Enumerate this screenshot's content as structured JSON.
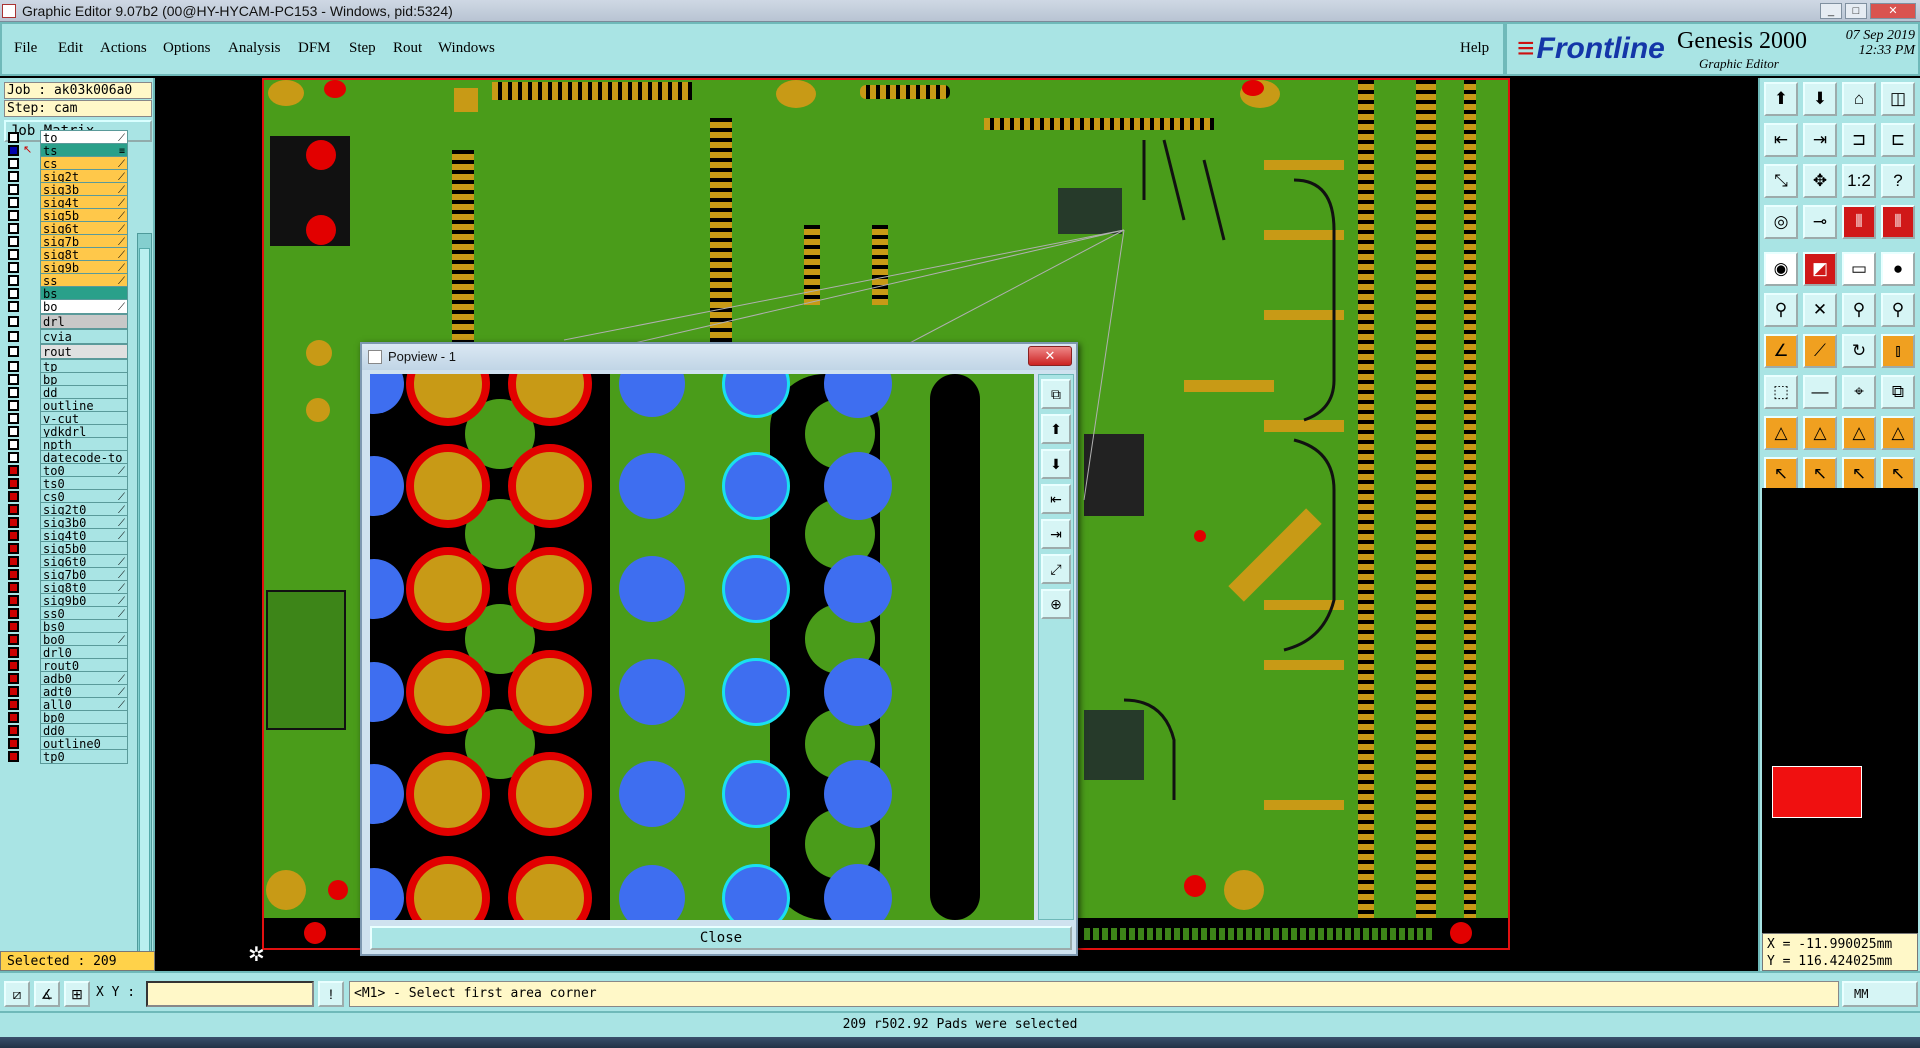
{
  "window": {
    "title": "Graphic Editor 9.07b2 (00@HY-HYCAM-PC153 - Windows, pid:5324)",
    "min": "_",
    "max": "□",
    "close": "✕"
  },
  "menu": {
    "items": [
      "File",
      "Edit",
      "Actions",
      "Options",
      "Analysis",
      "DFM",
      "Step",
      "Rout",
      "Windows"
    ],
    "help": "Help"
  },
  "brand": {
    "logo": "Frontline",
    "product": "Genesis 2000",
    "subtitle": "Graphic Editor",
    "date": "07 Sep 2019",
    "time": "12:33 PM"
  },
  "job": {
    "job_label": "Job : ak03k006a0",
    "step_label": "Step: cam",
    "matrix_button": "Job Matrix ..."
  },
  "layers": [
    {
      "name": "to",
      "color": "#ffffff",
      "check": "white",
      "mark": "⟋"
    },
    {
      "name": "ts",
      "color": "#2aa08a",
      "check": "blue",
      "mark": "≡",
      "arrow": true
    },
    {
      "name": "cs",
      "color": "#ffc84a",
      "check": "white",
      "mark": "⟋"
    },
    {
      "name": "sig2t",
      "color": "#ffc84a",
      "check": "white",
      "mark": "⟋"
    },
    {
      "name": "sig3b",
      "color": "#ffc84a",
      "check": "white",
      "mark": "⟋"
    },
    {
      "name": "sig4t",
      "color": "#ffc84a",
      "check": "white",
      "mark": "⟋"
    },
    {
      "name": "sig5b",
      "color": "#ffc84a",
      "check": "white",
      "mark": "⟋"
    },
    {
      "name": "sig6t",
      "color": "#ffc84a",
      "check": "white",
      "mark": "⟋"
    },
    {
      "name": "sig7b",
      "color": "#ffc84a",
      "check": "white",
      "mark": "⟋"
    },
    {
      "name": "sig8t",
      "color": "#ffc84a",
      "check": "white",
      "mark": "⟋"
    },
    {
      "name": "sig9b",
      "color": "#ffc84a",
      "check": "white",
      "mark": "⟋"
    },
    {
      "name": "ss",
      "color": "#ffc84a",
      "check": "white",
      "mark": "⟋"
    },
    {
      "name": "bs",
      "color": "#2aa08a",
      "check": "white",
      "mark": ""
    },
    {
      "name": "bo",
      "color": "#ffffff",
      "check": "white",
      "mark": "⟋"
    },
    {
      "name": "drl",
      "color": "#c8c8c8",
      "check": "white",
      "mark": ""
    },
    {
      "name": "cvia",
      "color": "#a9e4e4",
      "check": "white",
      "mark": ""
    },
    {
      "name": "rout",
      "color": "#e0e0e0",
      "check": "white",
      "mark": ""
    },
    {
      "name": "tp",
      "color": "#a9e4e4",
      "check": "white",
      "mark": ""
    },
    {
      "name": "bp",
      "color": "#a9e4e4",
      "check": "white",
      "mark": ""
    },
    {
      "name": "dd",
      "color": "#a9e4e4",
      "check": "white",
      "mark": ""
    },
    {
      "name": "outline",
      "color": "#a9e4e4",
      "check": "white",
      "mark": ""
    },
    {
      "name": "v-cut",
      "color": "#a9e4e4",
      "check": "white",
      "mark": ""
    },
    {
      "name": "ydkdrl",
      "color": "#a9e4e4",
      "check": "white",
      "mark": ""
    },
    {
      "name": "npth",
      "color": "#a9e4e4",
      "check": "white",
      "mark": ""
    },
    {
      "name": "datecode-to",
      "color": "#a9e4e4",
      "check": "white",
      "mark": ""
    },
    {
      "name": "to0",
      "color": "#a9e4e4",
      "check": "red",
      "mark": "⟋"
    },
    {
      "name": "ts0",
      "color": "#a9e4e4",
      "check": "red",
      "mark": ""
    },
    {
      "name": "cs0",
      "color": "#a9e4e4",
      "check": "red",
      "mark": "⟋"
    },
    {
      "name": "sig2t0",
      "color": "#a9e4e4",
      "check": "red",
      "mark": "⟋"
    },
    {
      "name": "sig3b0",
      "color": "#a9e4e4",
      "check": "red",
      "mark": "⟋"
    },
    {
      "name": "sig4t0",
      "color": "#a9e4e4",
      "check": "red",
      "mark": "⟋"
    },
    {
      "name": "sig5b0",
      "color": "#a9e4e4",
      "check": "red",
      "mark": ""
    },
    {
      "name": "sig6t0",
      "color": "#a9e4e4",
      "check": "red",
      "mark": "⟋"
    },
    {
      "name": "sig7b0",
      "color": "#a9e4e4",
      "check": "red",
      "mark": "⟋"
    },
    {
      "name": "sig8t0",
      "color": "#a9e4e4",
      "check": "red",
      "mark": "⟋"
    },
    {
      "name": "sig9b0",
      "color": "#a9e4e4",
      "check": "red",
      "mark": "⟋"
    },
    {
      "name": "ss0",
      "color": "#a9e4e4",
      "check": "red",
      "mark": "⟋"
    },
    {
      "name": "bs0",
      "color": "#a9e4e4",
      "check": "red",
      "mark": ""
    },
    {
      "name": "bo0",
      "color": "#a9e4e4",
      "check": "red",
      "mark": "⟋"
    },
    {
      "name": "drl0",
      "color": "#a9e4e4",
      "check": "red",
      "mark": ""
    },
    {
      "name": "rout0",
      "color": "#a9e4e4",
      "check": "red",
      "mark": ""
    },
    {
      "name": "adb0",
      "color": "#a9e4e4",
      "check": "red",
      "mark": "⟋"
    },
    {
      "name": "adt0",
      "color": "#a9e4e4",
      "check": "red",
      "mark": "⟋"
    },
    {
      "name": "all0",
      "color": "#a9e4e4",
      "check": "red",
      "mark": "⟋"
    },
    {
      "name": "bp0",
      "color": "#a9e4e4",
      "check": "red",
      "mark": ""
    },
    {
      "name": "dd0",
      "color": "#a9e4e4",
      "check": "red",
      "mark": ""
    },
    {
      "name": "outline0",
      "color": "#a9e4e4",
      "check": "red",
      "mark": ""
    },
    {
      "name": "tp0",
      "color": "#a9e4e4",
      "check": "red",
      "mark": ""
    }
  ],
  "selected": {
    "label": "Selected : 209"
  },
  "popup": {
    "title": "Popview - 1",
    "close_x": "✕",
    "close_button": "Close",
    "buttons": [
      "⧉",
      "⬆",
      "⬇",
      "⇤",
      "⇥",
      "⤢",
      "⊕"
    ]
  },
  "toolbar": {
    "rows": [
      [
        "⬆",
        "⬇",
        "⌂",
        "◫"
      ],
      [
        "⇤",
        "⇥",
        "⊐",
        "⊏"
      ],
      [
        "⤡",
        "✥",
        "1:2",
        "?"
      ],
      [
        "◎",
        "⊸",
        "⦀",
        "⦀"
      ],
      [
        "◉",
        "◩",
        "▭",
        "●"
      ],
      [
        "⚲",
        "✕",
        "⚲",
        "⚲"
      ],
      [
        "∠",
        "⟋",
        "↻",
        "⫾"
      ],
      [
        "⬚",
        "―",
        "⌖",
        "⧉"
      ],
      [
        "△",
        "△",
        "△",
        "△"
      ],
      [
        "↖",
        "↖",
        "↖",
        "↖"
      ]
    ]
  },
  "coords": {
    "x": "X = -11.990025mm",
    "y": "Y = 116.424025mm"
  },
  "bottom": {
    "xy_label": "X Y :",
    "xy_value": "",
    "prompt_icon": "!",
    "prompt": "<M1> - Select first area corner",
    "units": "MM"
  },
  "status": {
    "message": "209 r502.92 Pads were selected"
  },
  "colors": {
    "panel": "#a9e4e4",
    "board": "#4a9c1a",
    "copper": "#c89a16",
    "keepout": "#e21010",
    "via_blue": "#3e6ef0",
    "cyan_ring": "#19e0f0"
  }
}
